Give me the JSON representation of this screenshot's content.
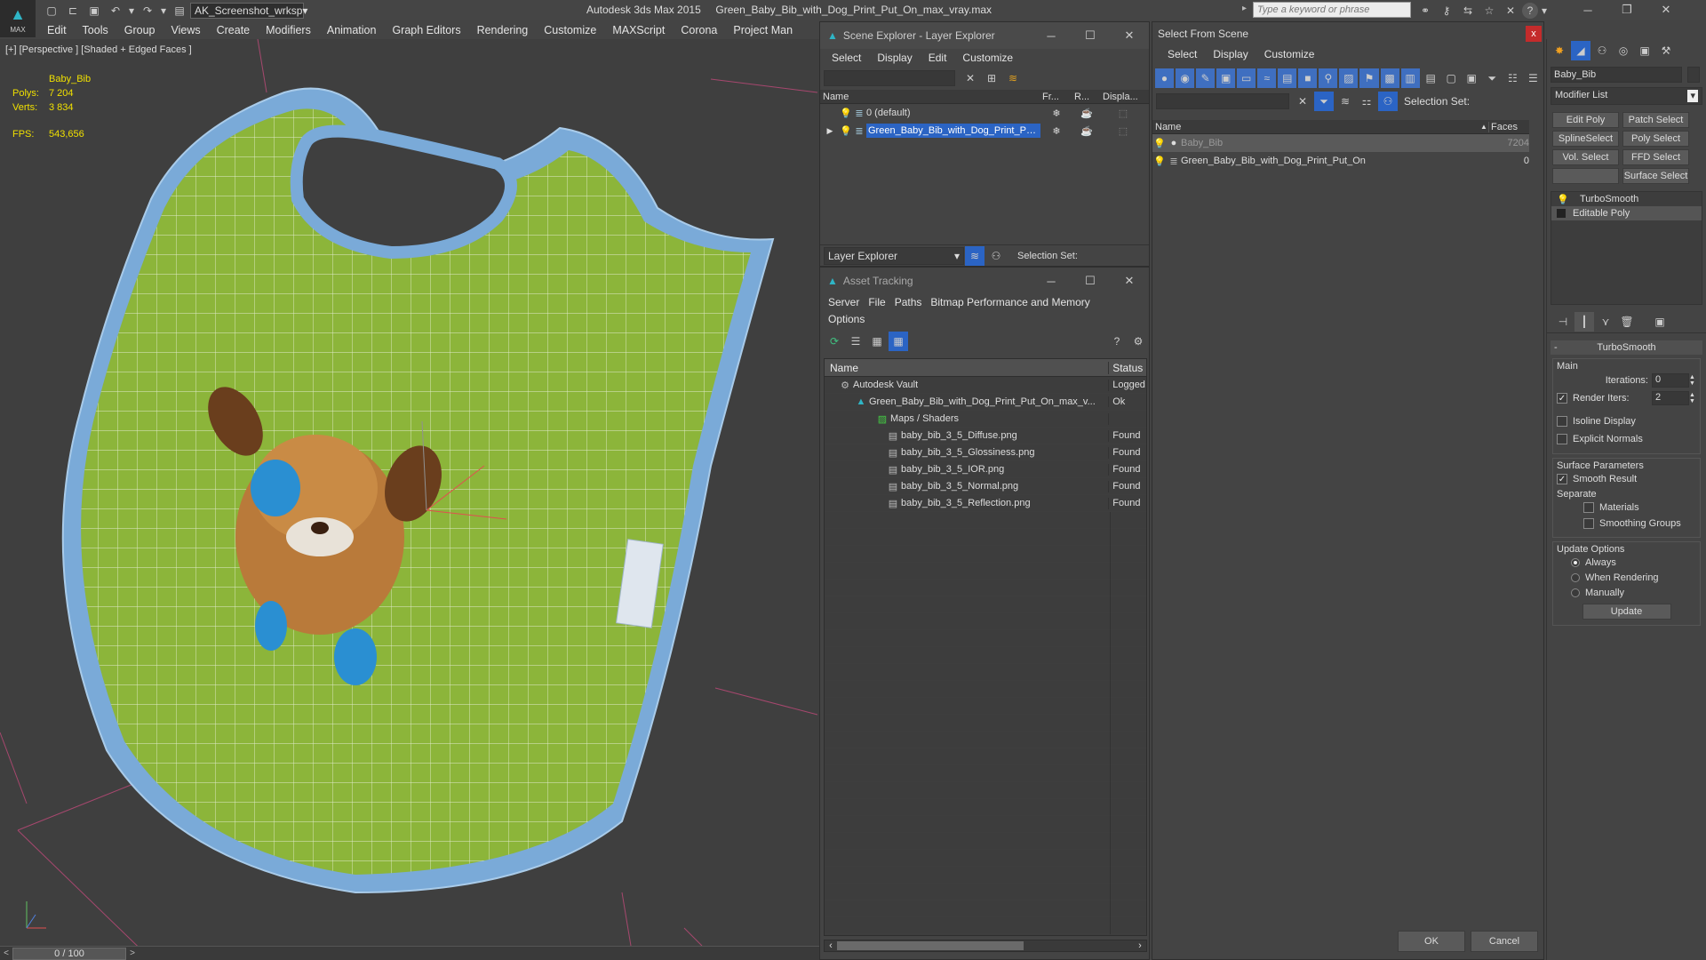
{
  "titlebar": {
    "workspace": "AK_Screenshot_wrksp",
    "app_title": "Autodesk 3ds Max  2015",
    "file_title": "Green_Baby_Bib_with_Dog_Print_Put_On_max_vray.max",
    "search_placeholder": "Type a keyword or phrase",
    "logo": "MAX"
  },
  "menubar": [
    "Edit",
    "Tools",
    "Group",
    "Views",
    "Create",
    "Modifiers",
    "Animation",
    "Graph Editors",
    "Rendering",
    "Customize",
    "MAXScript",
    "Corona",
    "Project Man"
  ],
  "viewport": {
    "label": "[+] [Perspective ] [Shaded + Edged Faces ]",
    "object_name": "Baby_Bib",
    "polys_label": "Polys:",
    "polys": "7 204",
    "verts_label": "Verts:",
    "verts": "3 834",
    "fps_label": "FPS:",
    "fps": "543,656",
    "timeline": "0 / 100",
    "timeline_progress": 0
  },
  "scene_explorer": {
    "title": "Scene Explorer - Layer Explorer",
    "menu": [
      "Select",
      "Display",
      "Edit",
      "Customize"
    ],
    "columns": [
      "Name",
      "Fr...",
      "R...",
      "Displa..."
    ],
    "rows": [
      {
        "name": "0 (default)"
      },
      {
        "name": "Green_Baby_Bib_with_Dog_Print_Put..."
      }
    ],
    "footer_label": "Layer Explorer",
    "selection_set": "Selection Set:"
  },
  "asset_tracking": {
    "title": "Asset Tracking",
    "menu": [
      "Server",
      "File",
      "Paths",
      "Bitmap Performance and Memory",
      "Options"
    ],
    "columns": [
      "Name",
      "Status"
    ],
    "rows": [
      {
        "name": "Autodesk Vault",
        "status": "Logged"
      },
      {
        "name": "Green_Baby_Bib_with_Dog_Print_Put_On_max_v...",
        "status": "Ok"
      },
      {
        "name": "Maps / Shaders",
        "status": ""
      },
      {
        "name": "baby_bib_3_5_Diffuse.png",
        "status": "Found"
      },
      {
        "name": "baby_bib_3_5_Glossiness.png",
        "status": "Found"
      },
      {
        "name": "baby_bib_3_5_IOR.png",
        "status": "Found"
      },
      {
        "name": "baby_bib_3_5_Normal.png",
        "status": "Found"
      },
      {
        "name": "baby_bib_3_5_Reflection.png",
        "status": "Found"
      }
    ]
  },
  "select_from_scene": {
    "title": "Select From Scene",
    "close": "x",
    "menu": [
      "Select",
      "Display",
      "Customize"
    ],
    "selection_set": "Selection Set:",
    "columns": [
      "Name",
      "Faces"
    ],
    "rows": [
      {
        "name": "Baby_Bib",
        "faces": "7204"
      },
      {
        "name": "Green_Baby_Bib_with_Dog_Print_Put_On",
        "faces": "0"
      }
    ],
    "ok": "OK",
    "cancel": "Cancel"
  },
  "command_panel": {
    "object_name": "Baby_Bib",
    "modifier_list": "Modifier List",
    "buttons": [
      "Edit Poly",
      "Patch Select",
      "SplineSelect",
      "Poly Select",
      "Vol. Select",
      "FFD Select",
      "",
      "Surface Select"
    ],
    "stack": [
      "TurboSmooth",
      "Editable Poly"
    ],
    "turbosmooth": {
      "title": "TurboSmooth",
      "main": "Main",
      "iterations_label": "Iterations:",
      "iterations": "0",
      "render_iters_label": "Render Iters:",
      "render_iters": "2",
      "isoline": "Isoline Display",
      "explicit": "Explicit Normals",
      "surface_params": "Surface Parameters",
      "smooth_result": "Smooth Result",
      "separate": "Separate",
      "materials": "Materials",
      "smoothing_groups": "Smoothing Groups",
      "update_options": "Update Options",
      "always": "Always",
      "when_rendering": "When Rendering",
      "manually": "Manually",
      "update": "Update"
    }
  },
  "colors": {
    "bg": "#444444",
    "panel": "#444444",
    "accent": "#2b64c4",
    "bib_green": "#8cb53a",
    "bib_edge": "#7aaad8"
  }
}
